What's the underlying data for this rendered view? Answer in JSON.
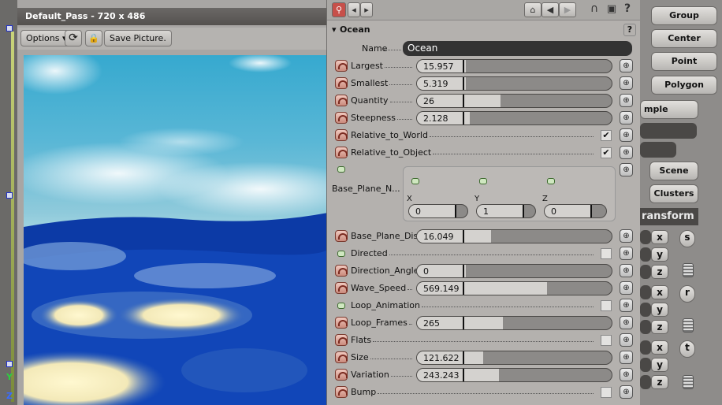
{
  "viewport": {
    "title": "Default_Pass - 720 x 486",
    "options_label": "Options",
    "save_label": "Save Picture.",
    "axis_y": "Y",
    "axis_z": "Z"
  },
  "panel": {
    "section_title": "Ocean",
    "help_label": "?",
    "name_label": "Name",
    "name_value": "Ocean",
    "params": [
      {
        "label": "Largest",
        "value": "15.957",
        "fill": 0.25,
        "type": "slider",
        "icon": "curve"
      },
      {
        "label": "Smallest",
        "value": "5.319",
        "fill": 0.25,
        "type": "slider",
        "icon": "curve"
      },
      {
        "label": "Quantity",
        "value": "26",
        "fill": 0.43,
        "type": "slider",
        "icon": "curve"
      },
      {
        "label": "Steepness",
        "value": "2.128",
        "fill": 0.27,
        "type": "slider",
        "icon": "curve"
      },
      {
        "label": "Relative_to_World",
        "checked": true,
        "type": "check",
        "icon": "curve"
      },
      {
        "label": "Relative_to_Object",
        "checked": true,
        "type": "check",
        "icon": "curve"
      }
    ],
    "base_plane_normal": {
      "label": "Base_Plane_N...",
      "x_label": "X",
      "y_label": "Y",
      "z_label": "Z",
      "x": "0",
      "y": "1",
      "z": "0"
    },
    "params2": [
      {
        "label": "Base_Plane_Distance",
        "value": "16.049",
        "fill": 0.38,
        "type": "slider",
        "icon": "curve"
      },
      {
        "label": "Directed",
        "checked": false,
        "type": "check",
        "icon": "dot"
      },
      {
        "label": "Direction_Angle",
        "value": "0",
        "fill": 0.25,
        "type": "slider",
        "icon": "curve"
      },
      {
        "label": "Wave_Speed",
        "value": "569.149",
        "fill": 0.67,
        "type": "slider",
        "icon": "curve"
      },
      {
        "label": "Loop_Animation",
        "checked": false,
        "type": "check",
        "icon": "dot"
      },
      {
        "label": "Loop_Frames",
        "value": "265",
        "fill": 0.44,
        "type": "slider",
        "icon": "curve"
      },
      {
        "label": "Flats",
        "checked": false,
        "type": "check",
        "icon": "curve"
      },
      {
        "label": "Size",
        "value": "121.622",
        "fill": 0.34,
        "type": "slider",
        "icon": "curve"
      },
      {
        "label": "Variation",
        "value": "243.243",
        "fill": 0.42,
        "type": "slider",
        "icon": "curve"
      },
      {
        "label": "Bump",
        "checked": false,
        "type": "check",
        "icon": "curve"
      }
    ]
  },
  "rightbar": {
    "group": "Group",
    "center": "Center",
    "point": "Point",
    "polygon": "Polygon",
    "sample": "mple",
    "scene": "Scene",
    "clusters": "Clusters",
    "transform": "ransform",
    "x": "x",
    "y": "y",
    "z": "z",
    "s": "s",
    "r": "r",
    "t": "t"
  }
}
